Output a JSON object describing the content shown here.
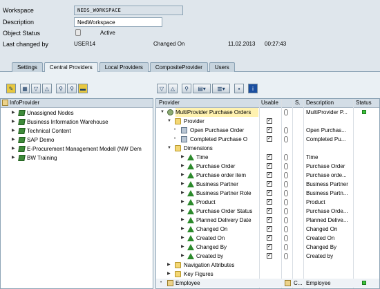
{
  "header": {
    "workspace_label": "Workspace",
    "workspace_value": "NEDS_WORKSPACE",
    "description_label": "Description",
    "description_value": "NedWorkspace",
    "status_label": "Object Status",
    "status_value": "Active",
    "last_changed_label": "Last changed by",
    "last_changed_value": "USER14",
    "changed_on_label": "Changed On",
    "changed_on_date": "11.02.2013",
    "changed_on_time": "00:27:43"
  },
  "tabs": [
    {
      "label": "Settings"
    },
    {
      "label": "Central Providers"
    },
    {
      "label": "Local Providers"
    },
    {
      "label": "CompositeProvider"
    },
    {
      "label": "Users"
    }
  ],
  "left_panel": {
    "header": "InfoProvider",
    "items": [
      {
        "label": "Unassigned Nodes"
      },
      {
        "label": "Business Information Warehouse"
      },
      {
        "label": "Technical Content"
      },
      {
        "label": "SAP Demo"
      },
      {
        "label": "E-Procurement Management Modell (NW Dem"
      },
      {
        "label": "BW Training"
      }
    ]
  },
  "right_panel": {
    "columns": {
      "provider": "Provider",
      "usable": "Usable",
      "s": "S.",
      "description": "Description",
      "status": "Status"
    },
    "rows": [
      {
        "provider": "MultiProvider Purchase Orders",
        "description": "MultiProvider P..."
      },
      {
        "provider": "Provider"
      },
      {
        "provider": "Open Purchase Order",
        "description": "Open Purchas..."
      },
      {
        "provider": "Completed Purchase O",
        "description": "Completed Pu..."
      },
      {
        "provider": "Dimensions"
      },
      {
        "provider": "Time",
        "description": "Time"
      },
      {
        "provider": "Purchase Order",
        "description": "Purchase Order"
      },
      {
        "provider": "Purchase order item",
        "description": "Purchase orde..."
      },
      {
        "provider": "Business Partner",
        "description": "Business Partner"
      },
      {
        "provider": "Business Partner Role",
        "description": "Business Partn..."
      },
      {
        "provider": "Product",
        "description": "Product"
      },
      {
        "provider": "Purchase Order Status",
        "description": "Purchase Orde..."
      },
      {
        "provider": "Planned Delivery Date",
        "description": "Planned Delive..."
      },
      {
        "provider": "Changed On",
        "description": "Changed On"
      },
      {
        "provider": "Created On",
        "description": "Created On"
      },
      {
        "provider": "Changed By",
        "description": "Changed By"
      },
      {
        "provider": "Created by",
        "description": "Created by"
      },
      {
        "provider": "Navigation Attributes"
      },
      {
        "provider": "Key Figures"
      },
      {
        "provider": "Employee",
        "s": "C...",
        "description": "Employee"
      }
    ]
  },
  "colors": {
    "background": "#dfe6ec",
    "highlight": "#fff2b0",
    "status_green": "#3cc23c"
  }
}
